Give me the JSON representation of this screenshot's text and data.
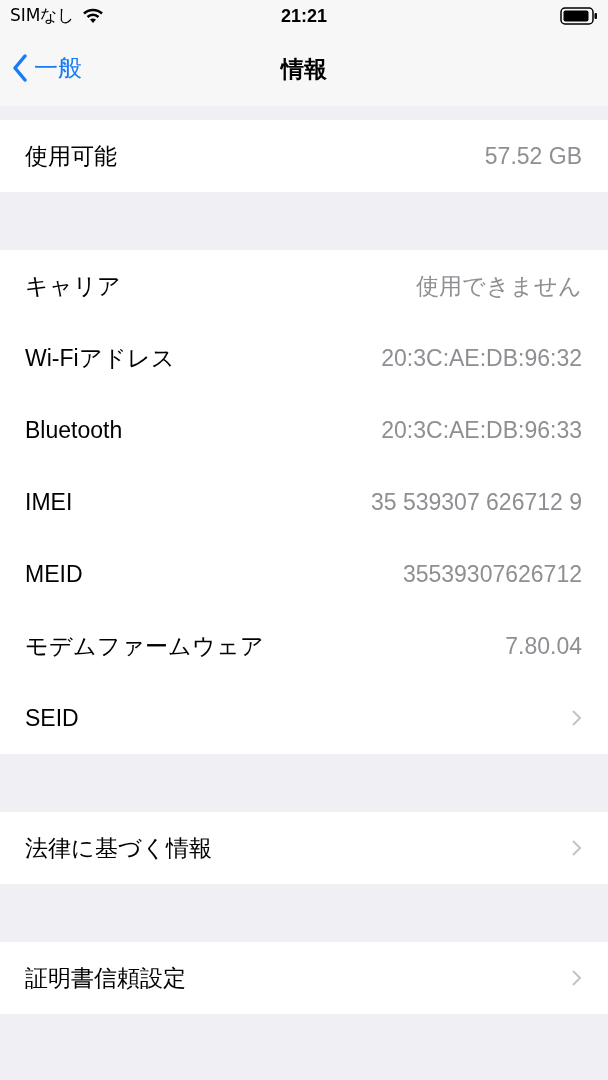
{
  "status_bar": {
    "carrier": "SIMなし",
    "time": "21:21"
  },
  "nav": {
    "back": "一般",
    "title": "情報"
  },
  "groups": [
    {
      "rows": [
        {
          "kind": "value",
          "label": "使用可能",
          "value": "57.52 GB"
        }
      ]
    },
    {
      "rows": [
        {
          "kind": "value",
          "label": "キャリア",
          "value": "使用できません"
        },
        {
          "kind": "value",
          "label": "Wi-Fiアドレス",
          "value": "20:3C:AE:DB:96:32"
        },
        {
          "kind": "value",
          "label": "Bluetooth",
          "value": "20:3C:AE:DB:96:33"
        },
        {
          "kind": "value",
          "label": "IMEI",
          "value": "35 539307 626712 9"
        },
        {
          "kind": "value",
          "label": "MEID",
          "value": "35539307626712"
        },
        {
          "kind": "value",
          "label": "モデムファームウェア",
          "value": "7.80.04"
        },
        {
          "kind": "link",
          "label": "SEID"
        }
      ]
    },
    {
      "rows": [
        {
          "kind": "link",
          "label": "法律に基づく情報"
        }
      ]
    },
    {
      "rows": [
        {
          "kind": "link",
          "label": "証明書信頼設定"
        }
      ]
    }
  ]
}
